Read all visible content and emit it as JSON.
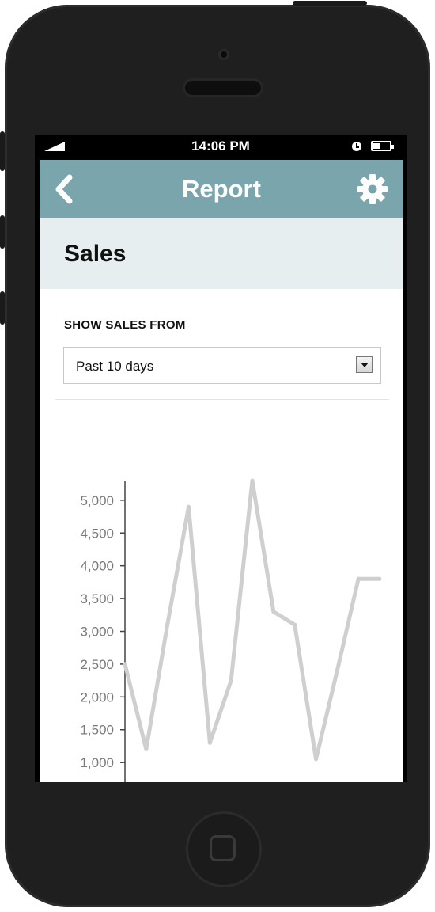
{
  "status_bar": {
    "time": "14:06 PM",
    "icons": [
      "signal-icon",
      "alarm-clock-icon",
      "battery-icon"
    ]
  },
  "header": {
    "title": "Report",
    "back_icon": "chevron-left-icon",
    "settings_icon": "gear-icon"
  },
  "colors": {
    "header_bg": "#7aa5ad",
    "subheader_bg": "#e6eeef",
    "line": "#cfcfcf",
    "axis_text": "#7a7a7a"
  },
  "page": {
    "title": "Sales"
  },
  "filter": {
    "label": "SHOW SALES FROM",
    "selected": "Past 10 days"
  },
  "chart_data": {
    "type": "line",
    "title": "",
    "xlabel": "",
    "ylabel": "",
    "x": [
      1,
      2,
      3,
      4,
      5,
      6,
      7,
      8,
      9,
      10,
      11,
      12,
      13
    ],
    "values": [
      2500,
      1200,
      3100,
      4900,
      1300,
      2250,
      5300,
      3300,
      3100,
      1050,
      2400,
      3800,
      3800
    ],
    "ylim": [
      700,
      5300
    ],
    "yticks": [
      1000,
      1500,
      2000,
      2500,
      3000,
      3500,
      4000,
      4500,
      5000
    ],
    "ytick_labels": [
      "1,000",
      "1,500",
      "2,000",
      "2,500",
      "3,000",
      "3,500",
      "4,000",
      "4,500",
      "5,000"
    ],
    "grid": false,
    "legend": "none"
  }
}
